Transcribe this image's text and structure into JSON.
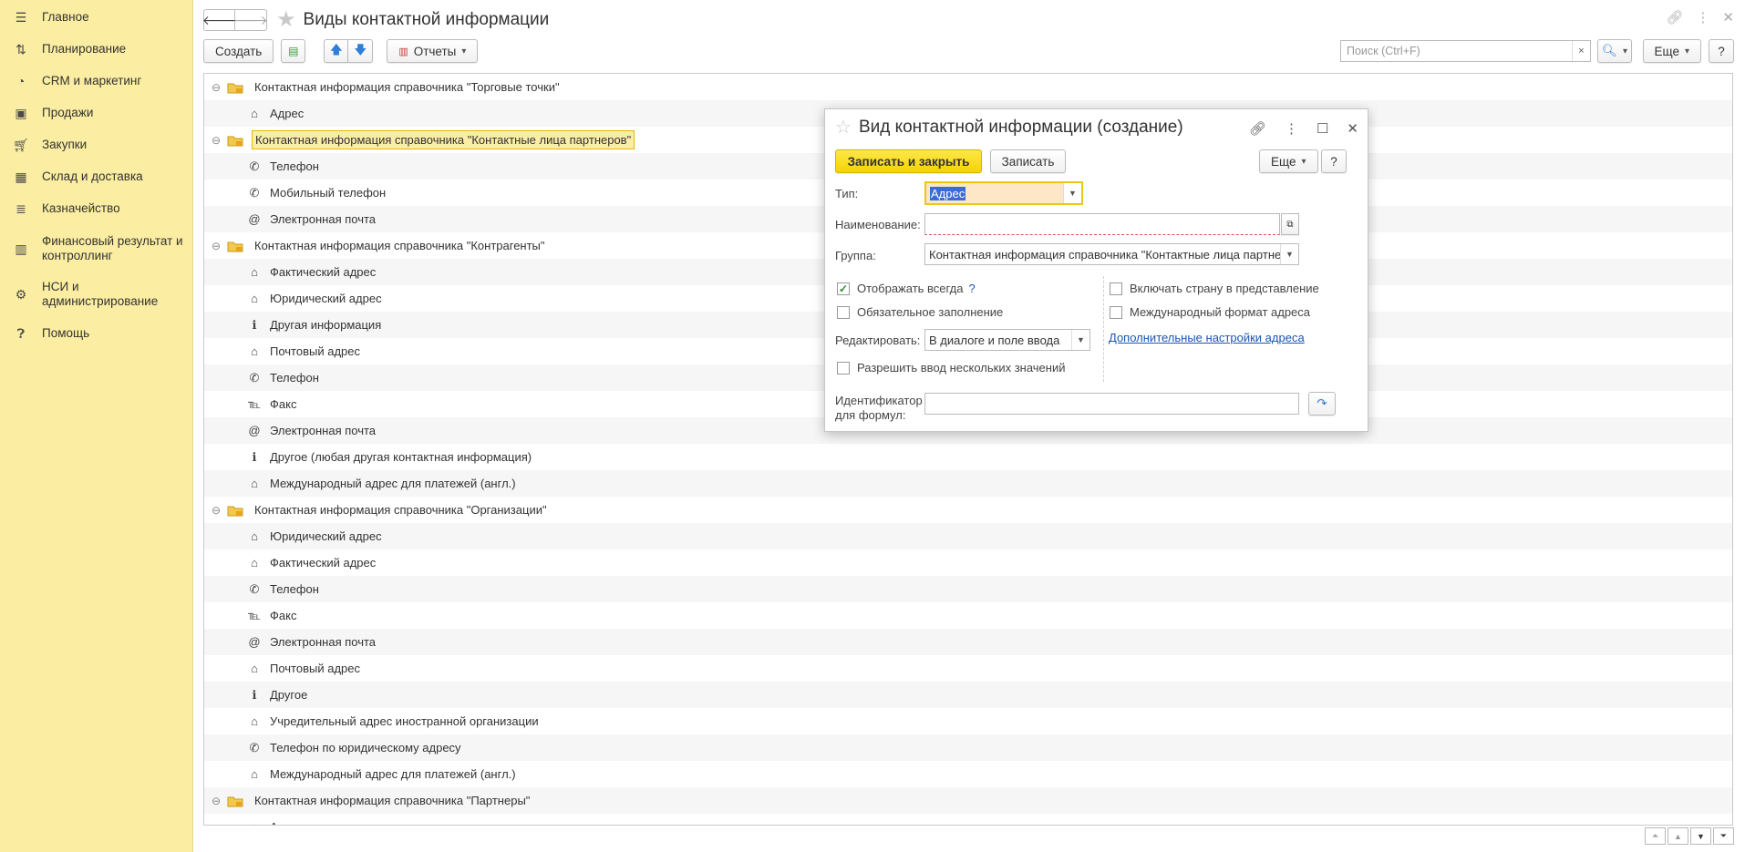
{
  "sidebar": {
    "items": [
      {
        "label": "Главное",
        "icon": "menu-icon"
      },
      {
        "label": "Планирование",
        "icon": "planning-icon"
      },
      {
        "label": "CRM и маркетинг",
        "icon": "crm-pie-icon"
      },
      {
        "label": "Продажи",
        "icon": "bag-icon"
      },
      {
        "label": "Закупки",
        "icon": "cart-icon"
      },
      {
        "label": "Склад и доставка",
        "icon": "warehouse-grid-icon"
      },
      {
        "label": "Казначейство",
        "icon": "treasury-icon"
      },
      {
        "label": "Финансовый результат и контроллинг",
        "icon": "bar-chart-icon"
      },
      {
        "label": "НСИ и администрирование",
        "icon": "gear-icon"
      },
      {
        "label": "Помощь",
        "icon": "help-icon"
      }
    ]
  },
  "header": {
    "title": "Виды контактной информации",
    "back_icon": "arrow-left-icon",
    "forward_icon": "arrow-right-icon"
  },
  "toolbar": {
    "create_label": "Создать",
    "reports_label": "Отчеты",
    "more_label": "Еще",
    "help_label": "?",
    "search_placeholder": "Поиск (Ctrl+F)",
    "search_clear": "×"
  },
  "list": {
    "rows": [
      {
        "type": "group",
        "label": "Контактная информация справочника \"Торговые точки\""
      },
      {
        "type": "item",
        "icon": "address-icon",
        "label": "Адрес"
      },
      {
        "type": "group",
        "label": "Контактная информация справочника \"Контактные лица партнеров\"",
        "selected": true
      },
      {
        "type": "item",
        "icon": "phone-icon",
        "label": "Телефон"
      },
      {
        "type": "item",
        "icon": "phone-icon",
        "label": "Мобильный телефон"
      },
      {
        "type": "item",
        "icon": "email-icon",
        "label": "Электронная почта"
      },
      {
        "type": "group",
        "label": "Контактная информация справочника \"Контрагенты\""
      },
      {
        "type": "item",
        "icon": "address-icon",
        "label": "Фактический адрес"
      },
      {
        "type": "item",
        "icon": "address-icon",
        "label": "Юридический адрес"
      },
      {
        "type": "item",
        "icon": "info-icon",
        "label": "Другая информация"
      },
      {
        "type": "item",
        "icon": "address-icon",
        "label": "Почтовый адрес"
      },
      {
        "type": "item",
        "icon": "phone-icon",
        "label": "Телефон"
      },
      {
        "type": "item",
        "icon": "fax-icon",
        "label": "Факс"
      },
      {
        "type": "item",
        "icon": "email-icon",
        "label": "Электронная почта"
      },
      {
        "type": "item",
        "icon": "info-icon",
        "label": "Другое (любая другая контактная информация)"
      },
      {
        "type": "item",
        "icon": "address-icon",
        "label": "Международный адрес для платежей (англ.)"
      },
      {
        "type": "group",
        "label": "Контактная информация справочника \"Организации\""
      },
      {
        "type": "item",
        "icon": "address-icon",
        "label": "Юридический адрес"
      },
      {
        "type": "item",
        "icon": "address-icon",
        "label": "Фактический адрес"
      },
      {
        "type": "item",
        "icon": "phone-icon",
        "label": "Телефон"
      },
      {
        "type": "item",
        "icon": "fax-icon",
        "label": "Факс"
      },
      {
        "type": "item",
        "icon": "email-icon",
        "label": "Электронная почта"
      },
      {
        "type": "item",
        "icon": "address-icon",
        "label": "Почтовый адрес"
      },
      {
        "type": "item",
        "icon": "info-icon",
        "label": "Другое"
      },
      {
        "type": "item",
        "icon": "address-icon",
        "label": "Учредительный адрес иностранной организации"
      },
      {
        "type": "item",
        "icon": "phone-icon",
        "label": "Телефон по юридическому адресу"
      },
      {
        "type": "item",
        "icon": "address-icon",
        "label": "Международный адрес для платежей (англ.)"
      },
      {
        "type": "group",
        "label": "Контактная информация справочника \"Партнеры\""
      },
      {
        "type": "item",
        "icon": "address-icon",
        "label": "Адрес"
      }
    ]
  },
  "dialog": {
    "title": "Вид контактной информации (создание)",
    "save_close_label": "Записать и закрыть",
    "save_label": "Записать",
    "more_label": "Еще",
    "help_label": "?",
    "type_label": "Тип:",
    "type_value": "Адрес",
    "name_label": "Наименование:",
    "name_value": "",
    "group_label": "Группа:",
    "group_value": "Контактная информация справочника \"Контактные лица партнер",
    "show_always_label": "Отображать всегда",
    "show_always_checked": true,
    "show_always_hint": "?",
    "required_label": "Обязательное заполнение",
    "required_checked": false,
    "edit_label": "Редактировать:",
    "edit_value": "В диалоге и поле ввода",
    "multiple_label": "Разрешить ввод нескольких значений",
    "multiple_checked": false,
    "include_country_label": "Включать страну в представление",
    "include_country_checked": false,
    "intl_format_label": "Международный формат адреса",
    "intl_format_checked": false,
    "address_settings_link": "Дополнительные настройки адреса",
    "formula_id_label_1": "Идентификатор",
    "formula_id_label_2": "для формул:",
    "formula_id_value": ""
  },
  "colors": {
    "sidebar_bg": "#fbeda1",
    "accent_yellow": "#f5d400",
    "selection_bg": "#fbeca6",
    "link": "#1a55b3"
  }
}
